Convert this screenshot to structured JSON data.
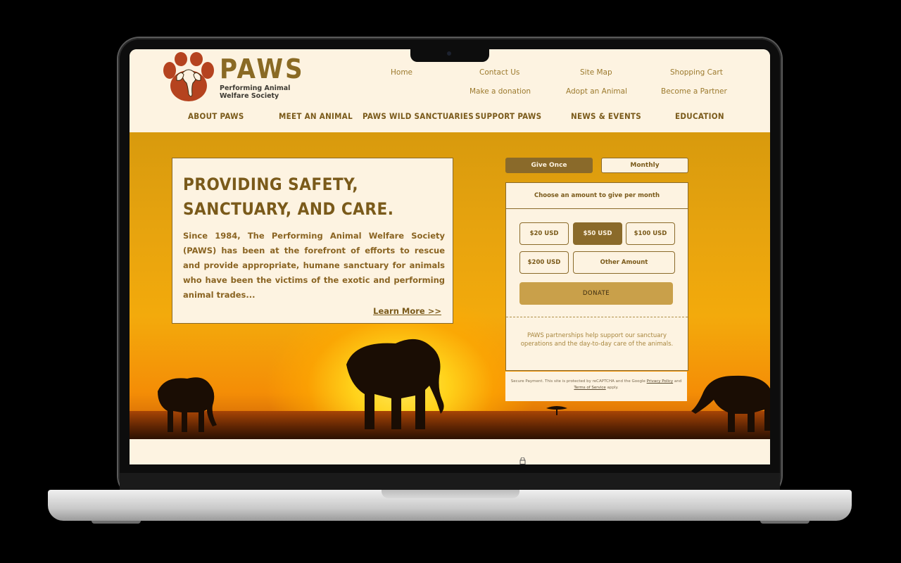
{
  "brand": {
    "name": "PAWS",
    "subtitle": "Performing Animal Welfare Society",
    "color": "#8a6a24",
    "logo_color": "#b5431f"
  },
  "utility_nav": {
    "row1": [
      "Home",
      "Contact Us",
      "Site Map",
      "Shopping Cart"
    ],
    "row2": [
      "Make a donation",
      "Adopt an Animal",
      "Become a Partner"
    ]
  },
  "main_nav": [
    "ABOUT PAWS",
    "MEET AN ANIMAL",
    "PAWS WILD SANCTUARIES",
    "SUPPORT PAWS",
    "NEWS & EVENTS",
    "EDUCATION"
  ],
  "hero": {
    "title_line1": "PROVIDING SAFETY,",
    "title_line2": "SANCTUARY, AND CARE.",
    "body": "Since 1984, The Performing Animal Welfare Society (PAWS) has been at the forefront of efforts to rescue and provide appropriate, humane sanctuary for animals who have been the victims of the exotic and performing animal trades...",
    "learn_more": "Learn More >>"
  },
  "donation": {
    "tabs": [
      "Give Once",
      "Monthly"
    ],
    "active_tab": "Give Once",
    "prompt": "Choose an amount to give per month",
    "amounts": [
      "$20 USD",
      "$50 USD",
      "$100 USD",
      "$200 USD",
      "Other Amount"
    ],
    "selected_amount": "$50 USD",
    "donate_label": "DONATE",
    "partner_text": "PAWS partnerships help support our sanctuary operations and the day-to-day care of the animals.",
    "secure_prefix": "Secure Payment. This site is protected by reCAPTCHA and the Google",
    "privacy": "Privacy Policy",
    "and": "and",
    "terms": "Terms of Service",
    "apply": "apply."
  },
  "colors": {
    "accent": "#8a6a2a",
    "background": "#fdf3e1",
    "donate_button": "#c9a04a"
  }
}
